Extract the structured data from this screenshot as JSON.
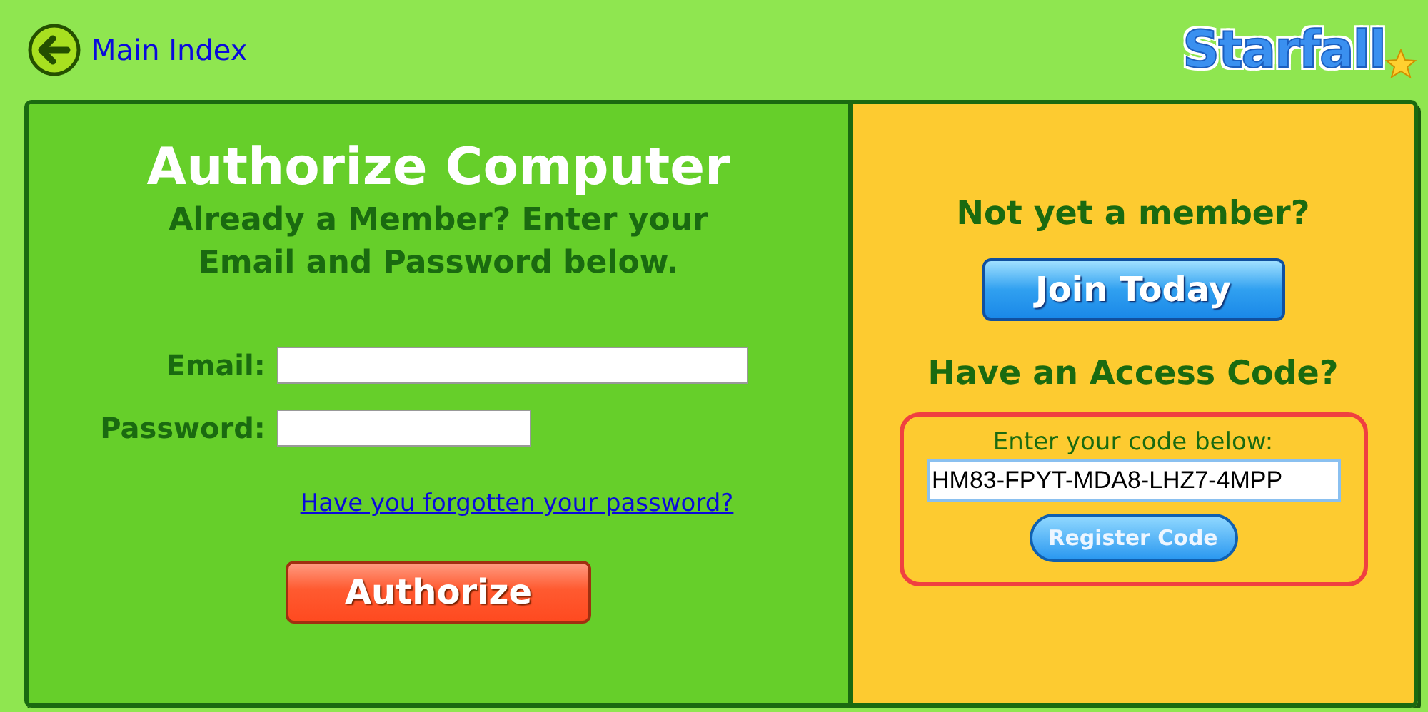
{
  "header": {
    "back_link": "Main Index",
    "logo": "Starfall"
  },
  "authorize": {
    "title": "Authorize Computer",
    "subtitle": "Already a Member? Enter your Email and Password below.",
    "fields": [
      {
        "label": "Email:",
        "kind": "email"
      },
      {
        "label": "Password:",
        "kind": "password"
      }
    ],
    "forgot_link": "Have you forgotten your password?",
    "button": "Authorize"
  },
  "membership": {
    "heading": "Not yet a member?",
    "join_button": "Join Today",
    "code_heading": "Have an Access Code?",
    "code_prompt": "Enter your code below:",
    "code_value": "HM83-FPYT-MDA8-LHZ7-4MPP",
    "register_button": "Register Code"
  }
}
